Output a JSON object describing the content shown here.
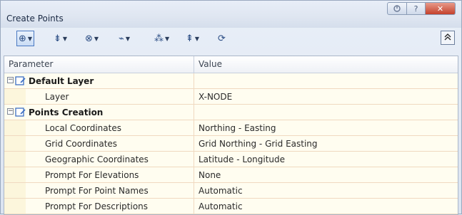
{
  "window": {
    "title": "Create Points",
    "caption_buttons": {
      "help": "?",
      "close": "✕"
    }
  },
  "toolbar": {
    "buttons": [
      {
        "name": "point-creation-icon",
        "glyph": "⊕"
      },
      {
        "name": "miscellaneous-points-icon",
        "glyph": "⇟"
      },
      {
        "name": "intersection-points-icon",
        "glyph": "⊗"
      },
      {
        "name": "alignment-points-icon",
        "glyph": "⌁"
      },
      {
        "name": "surface-points-icon",
        "glyph": "⁂"
      },
      {
        "name": "interpolate-points-icon",
        "glyph": "⇞"
      },
      {
        "name": "slope-points-icon",
        "glyph": "⟳"
      }
    ],
    "collapse_glyph": "≈"
  },
  "grid": {
    "headers": {
      "parameter": "Parameter",
      "value": "Value"
    },
    "rows": [
      {
        "type": "category",
        "parameter": "Default Layer",
        "value": "",
        "expander": "⊟"
      },
      {
        "type": "property",
        "parameter": "Layer",
        "value": "X-NODE"
      },
      {
        "type": "category",
        "parameter": "Points Creation",
        "value": "",
        "expander": "⊟"
      },
      {
        "type": "property",
        "parameter": "Local Coordinates",
        "value": "Northing - Easting"
      },
      {
        "type": "property",
        "parameter": "Grid Coordinates",
        "value": "Grid Northing - Grid Easting"
      },
      {
        "type": "property",
        "parameter": "Geographic Coordinates",
        "value": "Latitude - Longitude"
      },
      {
        "type": "property",
        "parameter": "Prompt For Elevations",
        "value": "None"
      },
      {
        "type": "property",
        "parameter": "Prompt For Point Names",
        "value": "Automatic"
      },
      {
        "type": "property",
        "parameter": "Prompt For Descriptions",
        "value": "Automatic"
      }
    ]
  },
  "colors": {
    "row_bg": "#fffdf0",
    "row_border": "#f0d9c0",
    "accent": "#2b4d84",
    "close_button": "#c4412b"
  }
}
